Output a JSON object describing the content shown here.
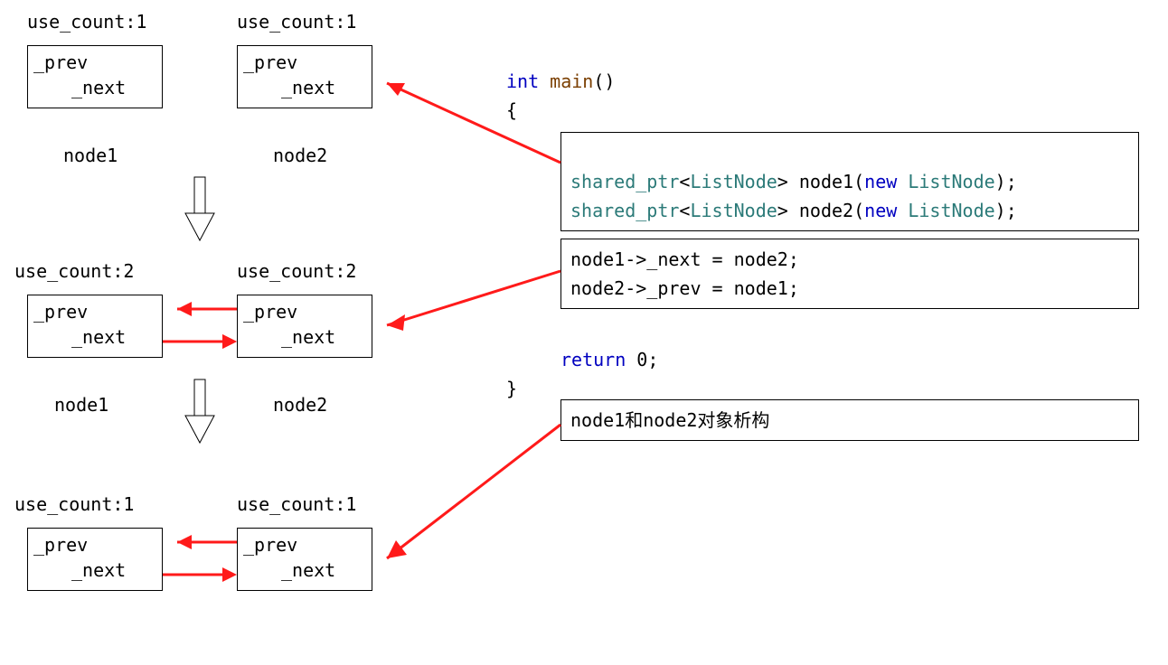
{
  "stage1": {
    "uc1": "use_count:1",
    "uc2": "use_count:1",
    "prev": "_prev",
    "next": "_next",
    "label1": "node1",
    "label2": "node2"
  },
  "stage2": {
    "uc1": "use_count:2",
    "uc2": "use_count:2",
    "prev": "_prev",
    "next": "_next",
    "label1": "node1",
    "label2": "node2"
  },
  "stage3": {
    "uc1": "use_count:1",
    "uc2": "use_count:1",
    "prev": "_prev",
    "next": "_next",
    "label1_cut": "   ",
    "label2_cut": "   "
  },
  "code": {
    "int": "int",
    "main": "main",
    "parens": "()",
    "obrace": "{",
    "cbrace": "}",
    "shared_ptr": "shared_ptr",
    "lt": "<",
    "gt": ">",
    "ListNode": "ListNode",
    "sp": " ",
    "node1": "node1",
    "node2": "node2",
    "oparen": "(",
    "cparen": ")",
    "new": "new",
    "semi": ";",
    "line_b1": "node1->_next = node2;",
    "line_b2": "node2->_prev = node1;",
    "return": "return",
    "zero": " 0",
    "line_c1": "node1和node2对象析构"
  }
}
